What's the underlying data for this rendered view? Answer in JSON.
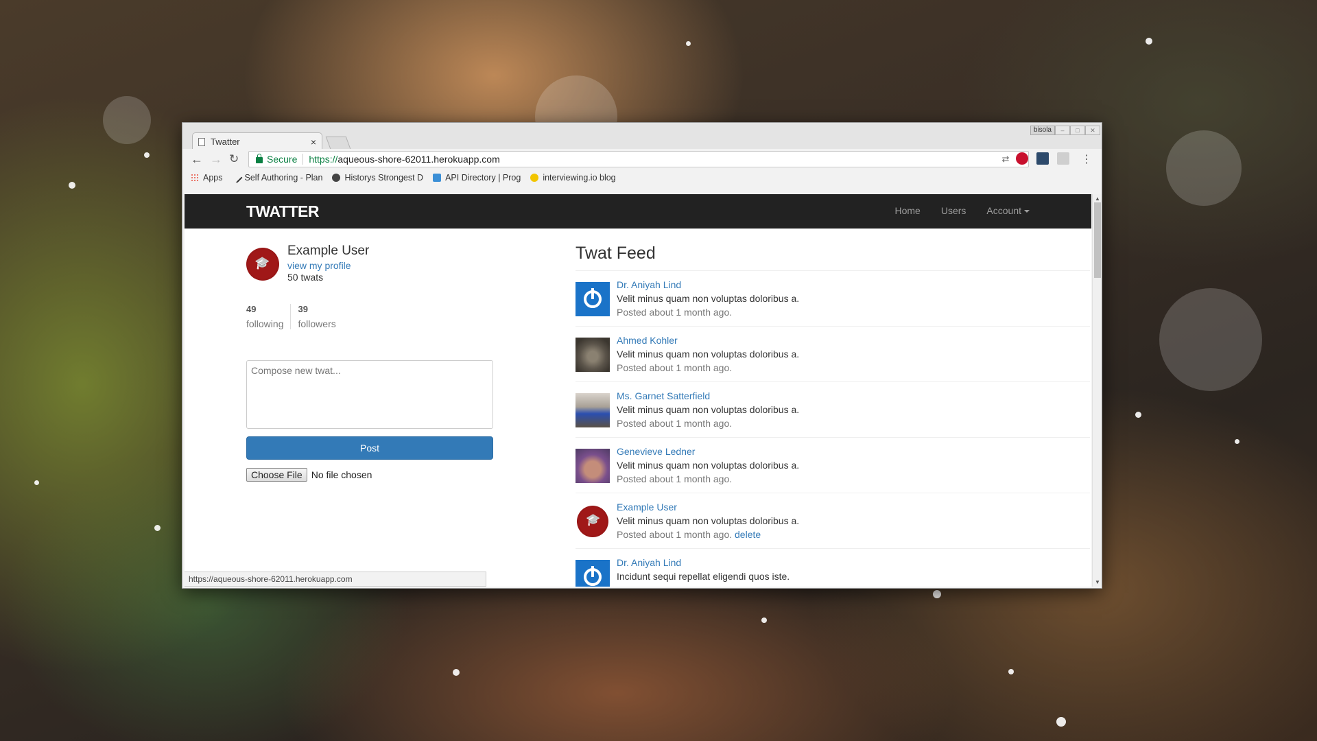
{
  "browser": {
    "tab_title": "Twatter",
    "tab_close": "×",
    "profile_chip": "bisola",
    "url_secure_label": "Secure",
    "url_protocol": "https://",
    "url_host": "aqueous-shore-62011.herokuapp.com",
    "bookmarks": [
      {
        "label": "Apps",
        "icon": "apps-grid-icon"
      },
      {
        "label": "Self Authoring - Plan",
        "icon": "pen-icon"
      },
      {
        "label": "Historys Strongest D",
        "icon": "fighter-icon"
      },
      {
        "label": "API Directory | Prog",
        "icon": "puzzle-icon"
      },
      {
        "label": "interviewing.io blog",
        "icon": "face-icon"
      }
    ],
    "status_url": "https://aqueous-shore-62011.herokuapp.com",
    "accent": "#337ab7"
  },
  "navbar": {
    "brand": "TWATTER",
    "links": [
      "Home",
      "Users",
      "Account"
    ]
  },
  "sidebar": {
    "user_name": "Example User",
    "view_profile": "view my profile",
    "twat_count": "50 twats",
    "following_count": "49",
    "following_label": "following",
    "followers_count": "39",
    "followers_label": "followers",
    "compose_placeholder": "Compose new twat...",
    "post_button": "Post",
    "choose_file": "Choose File",
    "no_file": "No file chosen"
  },
  "feed": {
    "title": "Twat Feed",
    "posts": [
      {
        "author": "Dr. Aniyah Lind",
        "content": "Velit minus quam non voluptas doloribus a.",
        "time": "Posted about 1 month ago.",
        "avatar": "power-icon"
      },
      {
        "author": "Ahmed Kohler",
        "content": "Velit minus quam non voluptas doloribus a.",
        "time": "Posted about 1 month ago.",
        "avatar": "cat-photo"
      },
      {
        "author": "Ms. Garnet Satterfield",
        "content": "Velit minus quam non voluptas doloribus a.",
        "time": "Posted about 1 month ago.",
        "avatar": "person-photo"
      },
      {
        "author": "Genevieve Ledner",
        "content": "Velit minus quam non voluptas doloribus a.",
        "time": "Posted about 1 month ago.",
        "avatar": "baby-photo"
      },
      {
        "author": "Example User",
        "content": "Velit minus quam non voluptas doloribus a.",
        "time": "Posted about 1 month ago.",
        "delete": "delete",
        "avatar": "graduation-cap-icon"
      },
      {
        "author": "Dr. Aniyah Lind",
        "content": "Incidunt sequi repellat eligendi quos iste.",
        "time": "",
        "avatar": "power-icon"
      }
    ]
  }
}
